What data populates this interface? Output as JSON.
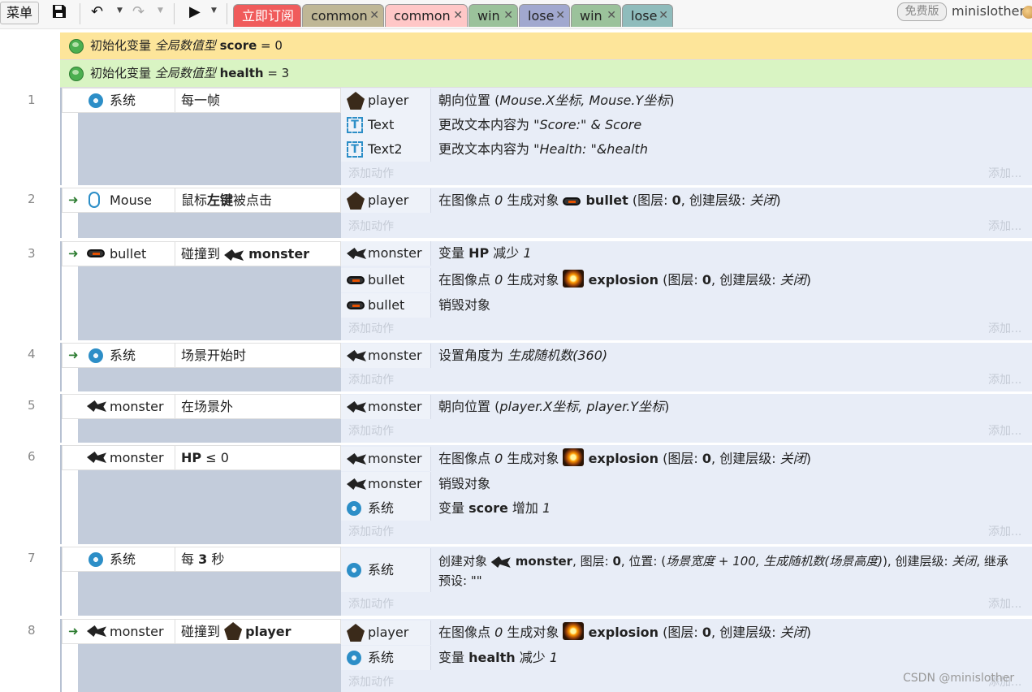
{
  "toolbar": {
    "menu_label": "菜单",
    "badge": "免费版",
    "username": "minislother"
  },
  "tabs": [
    {
      "label": "立即订阅",
      "color": "#f05b5b"
    },
    {
      "label": "common",
      "color": "#bfb796"
    },
    {
      "label": "common",
      "color": "#ffc7c7"
    },
    {
      "label": "win",
      "color": "#9bc29b"
    },
    {
      "label": "lose",
      "color": "#a1a8cf"
    },
    {
      "label": "win",
      "color": "#9bc29b"
    },
    {
      "label": "lose",
      "color": "#8fbcbc"
    }
  ],
  "globals": [
    {
      "prefix": "初始化变量 ",
      "type": "全局数值型",
      "name": "score",
      "suffix": " = 0",
      "color": "#fde59a"
    },
    {
      "prefix": "初始化变量 ",
      "type": "全局数值型",
      "name": "health",
      "suffix": " = 3",
      "color": "#d9f4c3"
    }
  ],
  "add_action": "添加动作",
  "add_short": "添加...",
  "events": {
    "e1": {
      "num": "1",
      "obj": "系统",
      "cond": "每一帧",
      "a1": {
        "obj": "player",
        "t1": "朝向位置 (",
        "t2": "Mouse.X坐标, Mouse.Y坐标",
        "t3": ")"
      },
      "a2": {
        "obj": "Text",
        "t1": "更改文本内容为 ",
        "t2": "\"Score:\" & Score"
      },
      "a3": {
        "obj": "Text2",
        "t1": "更改文本内容为 ",
        "t2": "\"Health: \"&health"
      }
    },
    "e2": {
      "num": "2",
      "obj": "Mouse",
      "c1": "鼠标",
      "c2": "左键",
      "c3": "被点击",
      "a1": {
        "obj": "player",
        "t1": "在图像点 ",
        "t2": "0",
        "t3": " 生成对象 ",
        "t4": "bullet",
        "t5": " (图层: ",
        "t6": "0",
        ",t7": "",
        "t8": ", 创建层级: ",
        "t9": "关闭",
        "t10": ")"
      }
    },
    "e3": {
      "num": "3",
      "obj": "bullet",
      "c1": "碰撞到 ",
      "c2": "monster",
      "a1": {
        "obj": "monster",
        "t1": "变量 ",
        "t2": "HP",
        "t3": " 减少 ",
        "t4": "1"
      },
      "a2": {
        "obj": "bullet",
        "t1": "在图像点 ",
        "t2": "0",
        "t3": " 生成对象 ",
        "t4": "explosion",
        "t5": " (图层: ",
        "t6": "0",
        "t8": ", 创建层级: ",
        "t9": "关闭",
        "t10": ")"
      },
      "a3": {
        "obj": "bullet",
        "t1": "销毁对象"
      }
    },
    "e4": {
      "num": "4",
      "obj": "系统",
      "cond": "场景开始时",
      "a1": {
        "obj": "monster",
        "t1": "设置角度为 ",
        "t2": "生成随机数(360)"
      }
    },
    "e5": {
      "num": "5",
      "obj": "monster",
      "cond": "在场景外",
      "a1": {
        "obj": "monster",
        "t1": "朝向位置 (",
        "t2": "player.X坐标, player.Y坐标",
        "t3": ")"
      }
    },
    "e6": {
      "num": "6",
      "obj": "monster",
      "c1": "HP",
      "c2": " ≤ 0",
      "a1": {
        "obj": "monster",
        "t1": "在图像点 ",
        "t2": "0",
        "t3": " 生成对象 ",
        "t4": "explosion",
        "t5": " (图层: ",
        "t6": "0",
        "t8": ", 创建层级: ",
        "t9": "关闭",
        "t10": ")"
      },
      "a2": {
        "obj": "monster",
        "t1": "销毁对象"
      },
      "a3": {
        "obj": "系统",
        "t1": "变量 ",
        "t2": "score",
        "t3": " 增加 ",
        "t4": "1"
      }
    },
    "e7": {
      "num": "7",
      "obj": "系统",
      "c1": "每 ",
      "c2": "3",
      "c3": " 秒",
      "a1": {
        "obj": "系统",
        "t1": "创建对象 ",
        "t2": "monster",
        "t3": ", 图层: ",
        "t4": "0",
        "t5": ", 位置: (",
        "t6": "场景宽度 + 100, 生成随机数(场景高度)",
        "t7": "), 创建层级: ",
        "t8": "关闭",
        "t9": ", 继承",
        "t10": "预设: ",
        "t11": "\"\""
      }
    },
    "e8": {
      "num": "8",
      "obj": "monster",
      "c1": "碰撞到 ",
      "c2": "player",
      "a1": {
        "obj": "player",
        "t1": "在图像点 ",
        "t2": "0",
        "t3": " 生成对象 ",
        "t4": "explosion",
        "t5": " (图层: ",
        "t6": "0",
        "t8": ", 创建层级: ",
        "t9": "关闭",
        "t10": ")"
      },
      "a2": {
        "obj": "系统",
        "t1": "变量 ",
        "t2": "health",
        "t3": " 减少 ",
        "t4": "1"
      }
    }
  },
  "watermark": "CSDN @minislother"
}
